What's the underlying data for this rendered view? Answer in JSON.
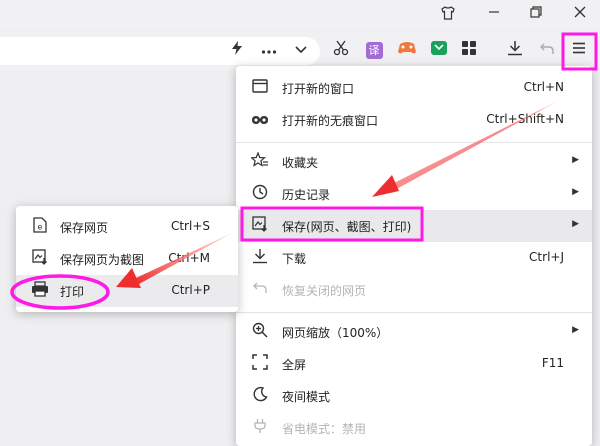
{
  "menu": {
    "items": [
      {
        "icon": "window-icon",
        "label": "打开新的窗口",
        "shortcut": "Ctrl+N"
      },
      {
        "icon": "incognito-icon",
        "label": "打开新的无痕窗口",
        "shortcut": "Ctrl+Shift+N"
      },
      {
        "icon": "star-list-icon",
        "label": "收藏夹",
        "shortcut": ""
      },
      {
        "icon": "clock-icon",
        "label": "历史记录",
        "shortcut": ""
      },
      {
        "icon": "save-icon",
        "label": "保存(网页、截图、打印)",
        "shortcut": ""
      },
      {
        "icon": "download-icon",
        "label": "下载",
        "shortcut": "Ctrl+J"
      },
      {
        "icon": "restore-icon",
        "label": "恢复关闭的网页",
        "shortcut": ""
      },
      {
        "icon": "zoom-icon",
        "label": "网页缩放（100%）",
        "shortcut": ""
      },
      {
        "icon": "fullscreen-icon",
        "label": "全屏",
        "shortcut": "F11"
      },
      {
        "icon": "moon-icon",
        "label": "夜间模式",
        "shortcut": ""
      },
      {
        "icon": "plug-icon",
        "label": "省电模式：禁用",
        "shortcut": ""
      }
    ]
  },
  "submenu": {
    "items": [
      {
        "icon": "save-page-icon",
        "label": "保存网页",
        "shortcut": "Ctrl+S"
      },
      {
        "icon": "screenshot-icon",
        "label": "保存网页为截图",
        "shortcut": "Ctrl+M"
      },
      {
        "icon": "printer-icon",
        "label": "打印",
        "shortcut": "Ctrl+P"
      }
    ]
  },
  "toolbar": {
    "translate_badge": "译"
  },
  "colors": {
    "highlight": "#ff19e6",
    "arrow": "#f03a3a",
    "active_row": "#e9e9eb"
  }
}
